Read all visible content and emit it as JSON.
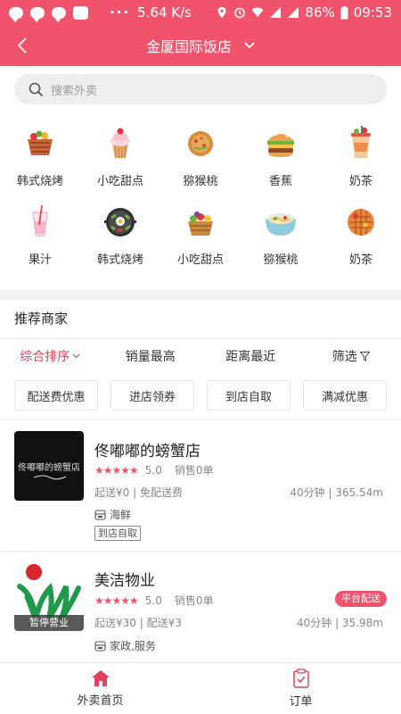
{
  "status_bar": {
    "network_speed": "5.64 K/s",
    "battery": "86%",
    "time": "09:53",
    "dots": "···",
    "app_badge": "微"
  },
  "nav": {
    "title": "金厦国际饭店"
  },
  "search": {
    "placeholder": "搜索外卖"
  },
  "categories": [
    {
      "label": "韩式烧烤",
      "icon": "basket-icon"
    },
    {
      "label": "小吃甜点",
      "icon": "cupcake-icon"
    },
    {
      "label": "猕猴桃",
      "icon": "pancake-icon"
    },
    {
      "label": "香蕉",
      "icon": "burger-icon"
    },
    {
      "label": "奶茶",
      "icon": "drink-cup-icon"
    },
    {
      "label": "果汁",
      "icon": "juice-glass-icon"
    },
    {
      "label": "韩式烧烤",
      "icon": "bibimbap-icon"
    },
    {
      "label": "小吃甜点",
      "icon": "fruit-basket-icon"
    },
    {
      "label": "猕猴桃",
      "icon": "noodle-bowl-icon"
    },
    {
      "label": "奶茶",
      "icon": "waffle-icon"
    }
  ],
  "section_title": "推荐商家",
  "sort_tabs": [
    {
      "label": "综合排序",
      "active": true
    },
    {
      "label": "销量最高",
      "active": false
    },
    {
      "label": "距离最近",
      "active": false
    },
    {
      "label": "筛选",
      "active": false
    }
  ],
  "filter_chips": [
    "配送费优惠",
    "进店领券",
    "到店自取",
    "满减优惠"
  ],
  "stores": [
    {
      "name": "佟嘟嘟的螃蟹店",
      "stars": "★★★★★",
      "rating": "5.0",
      "sales": "销售0单",
      "delivery_info": "起送¥0 | 免配送费",
      "distance": "40分钟 | 365.54m",
      "category": "海鲜",
      "pickup_tag": "到店自取",
      "thumb_text": "佟嘟嘟的螃蟹店"
    },
    {
      "name": "美洁物业",
      "stars": "★★★★★",
      "rating": "5.0",
      "sales": "销售0单",
      "delivery_info": "起送¥30 | 配送¥3",
      "distance": "40分钟 | 35.98m",
      "category": "家政,服务",
      "badge": "平台配送",
      "closed_label": "暂停营业"
    }
  ],
  "tabs": [
    {
      "label": "外卖首页",
      "icon": "home-icon"
    },
    {
      "label": "订单",
      "icon": "order-clipboard-icon"
    }
  ],
  "colors": {
    "brand": "#f0536b",
    "active_sort": "#e0445c"
  }
}
